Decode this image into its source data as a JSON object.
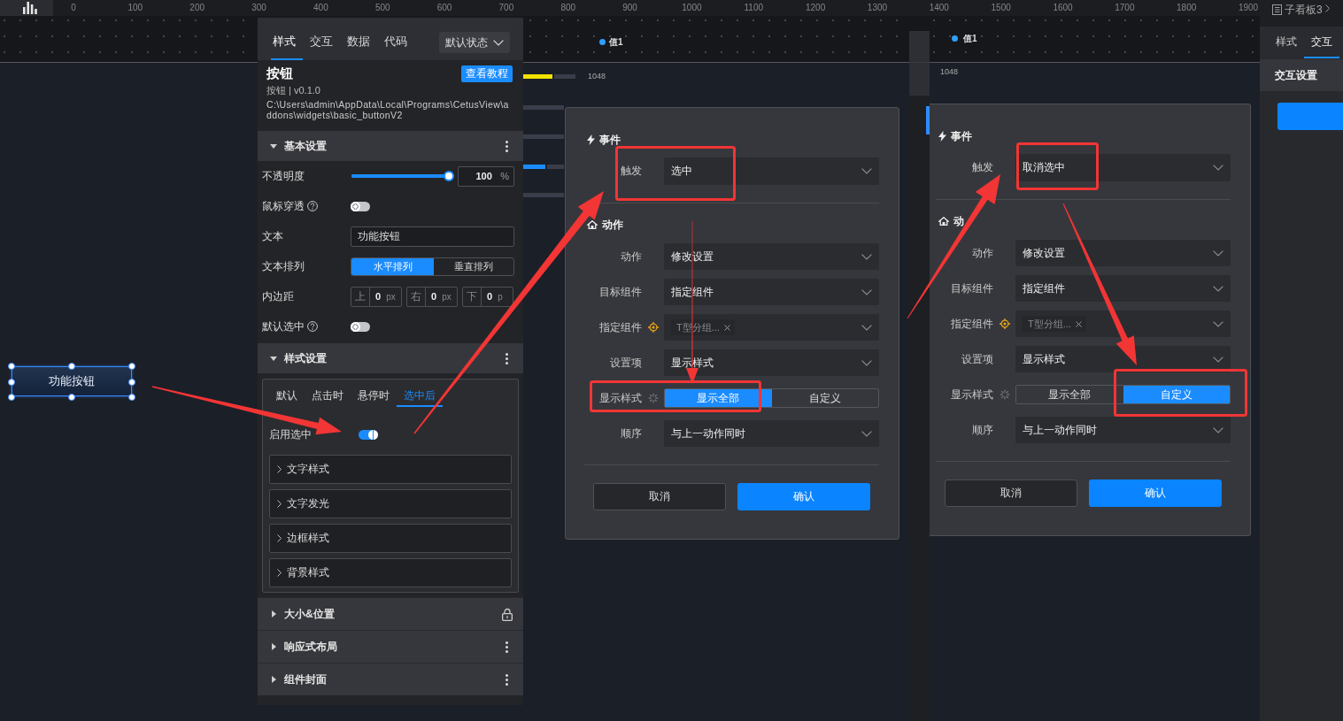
{
  "ruler": {
    "ticks": [
      "0",
      "100",
      "200",
      "300",
      "400",
      "500",
      "600",
      "700",
      "800",
      "900",
      "1000",
      "1100",
      "1200",
      "1300",
      "1400",
      "1500",
      "1600",
      "1700",
      "1800",
      "1900"
    ]
  },
  "canvas": {
    "widget": {
      "label": "功能按钮",
      "selected": true
    },
    "chart": {
      "legend": "值1",
      "value_label": "1048"
    }
  },
  "properties_panel": {
    "tabs": [
      {
        "label": "样式",
        "selected": true
      },
      {
        "label": "交互",
        "selected": false
      },
      {
        "label": "数据",
        "selected": false
      },
      {
        "label": "代码",
        "selected": false
      }
    ],
    "state_dropdown": "默认状态",
    "widget": {
      "title": "按钮",
      "tutorial_button": "查看教程",
      "version": "按钮 | v0.1.0",
      "path": "C:\\Users\\admin\\AppData\\Local\\Programs\\CetusView\\addons\\widgets\\basic_buttonV2"
    },
    "sections": [
      {
        "title": "基本设置",
        "expanded": true,
        "locked": false,
        "rows": [
          {
            "kind": "slider",
            "label": "不透明度",
            "help": false,
            "level": 1,
            "value": "100",
            "unit": "%"
          },
          {
            "kind": "toggle",
            "label": "鼠标穿透",
            "help": true,
            "on": false
          },
          {
            "kind": "text",
            "label": "文本",
            "help": false,
            "value": "功能按钮"
          },
          {
            "kind": "segmented",
            "label": "文本排列",
            "help": false,
            "options": [
              {
                "label": "水平排列",
                "selected": true
              },
              {
                "label": "垂直排列",
                "selected": false
              }
            ]
          },
          {
            "kind": "padding",
            "label": "内边距",
            "help": false,
            "fields": [
              {
                "side": "上",
                "value": "0",
                "unit": "px"
              },
              {
                "side": "右",
                "value": "0",
                "unit": "px"
              },
              {
                "side": "下",
                "value": "0",
                "unit": "p"
              }
            ]
          },
          {
            "kind": "toggle",
            "label": "默认选中",
            "help": true,
            "on": false
          }
        ]
      },
      {
        "title": "样式设置",
        "expanded": true,
        "locked": false,
        "state_tabs": [
          {
            "label": "默认",
            "selected": false
          },
          {
            "label": "点击时",
            "selected": false
          },
          {
            "label": "悬停时",
            "selected": false
          },
          {
            "label": "选中后",
            "selected": true
          }
        ],
        "enable_selected": {
          "label": "启用选中",
          "on": true
        },
        "groups": [
          {
            "label": "文字样式",
            "expanded": false
          },
          {
            "label": "文字发光",
            "expanded": false
          },
          {
            "label": "边框样式",
            "expanded": false
          },
          {
            "label": "背景样式",
            "expanded": false
          }
        ]
      },
      {
        "title": "大小&位置",
        "expanded": false,
        "locked": true
      },
      {
        "title": "响应式布局",
        "expanded": false,
        "locked": false
      },
      {
        "title": "组件封面",
        "expanded": false,
        "locked": false
      }
    ]
  },
  "dialogs": [
    {
      "event": {
        "title": "事件",
        "label": "触发",
        "value": "选中"
      },
      "action_title": "动作",
      "rows": [
        {
          "kind": "select",
          "label": "动作",
          "value": "修改设置"
        },
        {
          "kind": "select",
          "label": "目标组件",
          "value": "指定组件"
        },
        {
          "kind": "tags",
          "label": "指定组件",
          "tags": [
            "T型分组..."
          ]
        },
        {
          "kind": "select",
          "label": "设置项",
          "value": "显示样式"
        },
        {
          "kind": "segmented",
          "label": "显示样式",
          "options": [
            {
              "label": "显示全部",
              "selected": true
            },
            {
              "label": "自定义",
              "selected": false
            }
          ]
        },
        {
          "kind": "select",
          "label": "顺序",
          "value": "与上一动作同时"
        }
      ],
      "buttons": [
        {
          "label": "取消",
          "primary": false
        },
        {
          "label": "确认",
          "primary": true
        }
      ]
    },
    {
      "event": {
        "title": "事件",
        "label": "触发",
        "value": "取消选中"
      },
      "action_title": "动",
      "rows": [
        {
          "kind": "select",
          "label": "动作",
          "value": "修改设置"
        },
        {
          "kind": "select",
          "label": "目标组件",
          "value": "指定组件"
        },
        {
          "kind": "tags",
          "label": "指定组件",
          "tags": [
            "T型分组..."
          ]
        },
        {
          "kind": "select",
          "label": "设置项",
          "value": "显示样式"
        },
        {
          "kind": "segmented",
          "label": "显示样式",
          "options": [
            {
              "label": "显示全部",
              "selected": false
            },
            {
              "label": "自定义",
              "selected": true
            }
          ]
        },
        {
          "kind": "select",
          "label": "顺序",
          "value": "与上一动作同时"
        }
      ],
      "buttons": [
        {
          "label": "取消",
          "primary": false
        },
        {
          "label": "确认",
          "primary": true
        }
      ]
    }
  ],
  "second_canvas": {
    "chart": {
      "legend": "值1",
      "value_label": "1048"
    }
  },
  "right_panel": {
    "breadcrumb": "子看板3",
    "tabs": [
      {
        "label": "样式",
        "selected": false
      },
      {
        "label": "交互",
        "selected": true
      }
    ],
    "section_title": "交互设置"
  }
}
